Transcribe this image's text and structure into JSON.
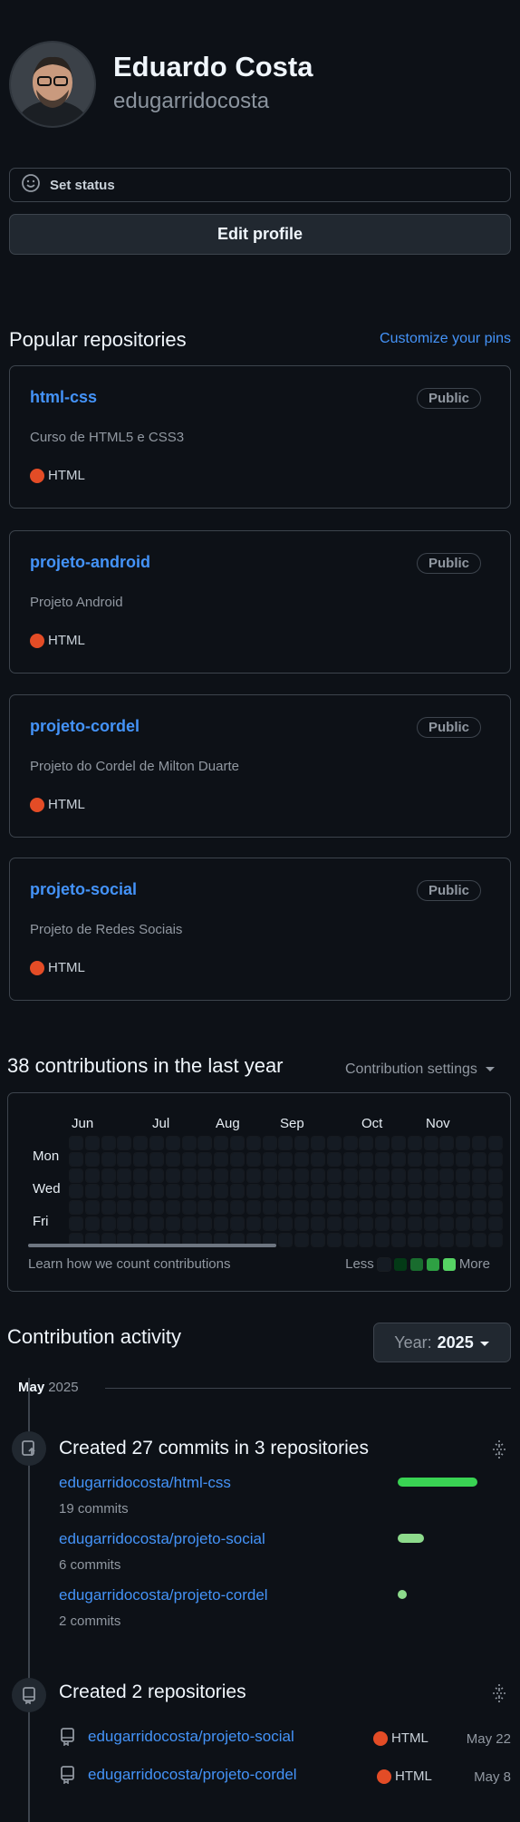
{
  "profile": {
    "name": "Eduardo Costa",
    "login": "edugarridocosta",
    "set_status": "Set status",
    "edit_profile": "Edit profile"
  },
  "popular": {
    "title": "Popular repositories",
    "customize": "Customize your pins",
    "repos": [
      {
        "name": "html-css",
        "visibility": "Public",
        "description": "Curso de HTML5 e CSS3",
        "language": "HTML"
      },
      {
        "name": "projeto-android",
        "visibility": "Public",
        "description": "Projeto Android",
        "language": "HTML"
      },
      {
        "name": "projeto-cordel",
        "visibility": "Public",
        "description": "Projeto do Cordel de Milton Duarte",
        "language": "HTML"
      },
      {
        "name": "projeto-social",
        "visibility": "Public",
        "description": "Projeto de Redes Sociais",
        "language": "HTML"
      }
    ]
  },
  "contributions": {
    "title": "38 contributions in the last year",
    "settings": "Contribution settings",
    "months": [
      "Jun",
      "Jul",
      "Aug",
      "Sep",
      "Oct",
      "Nov"
    ],
    "days": [
      "Mon",
      "Wed",
      "Fri"
    ],
    "learn": "Learn how we count contributions",
    "less": "Less",
    "more": "More"
  },
  "activity": {
    "title": "Contribution activity",
    "year_label": "Year:",
    "year_value": "2025",
    "month": "May",
    "month_year": "2025",
    "commits_title": "Created 27 commits in 3 repositories",
    "commits": [
      {
        "repo": "edugarridocosta/html-css",
        "count": "19 commits"
      },
      {
        "repo": "edugarridocosta/projeto-social",
        "count": "6 commits"
      },
      {
        "repo": "edugarridocosta/projeto-cordel",
        "count": "2 commits"
      }
    ],
    "repos_title": "Created 2 repositories",
    "created": [
      {
        "repo": "edugarridocosta/projeto-social",
        "language": "HTML",
        "date": "May 22"
      },
      {
        "repo": "edugarridocosta/projeto-cordel",
        "language": "HTML",
        "date": "May 8"
      }
    ]
  },
  "colors": {
    "background": "#0d1117",
    "link": "#4493f8",
    "html_language": "#e34c26",
    "green_high": "#39d353",
    "green_low": "#8ddb8c"
  }
}
